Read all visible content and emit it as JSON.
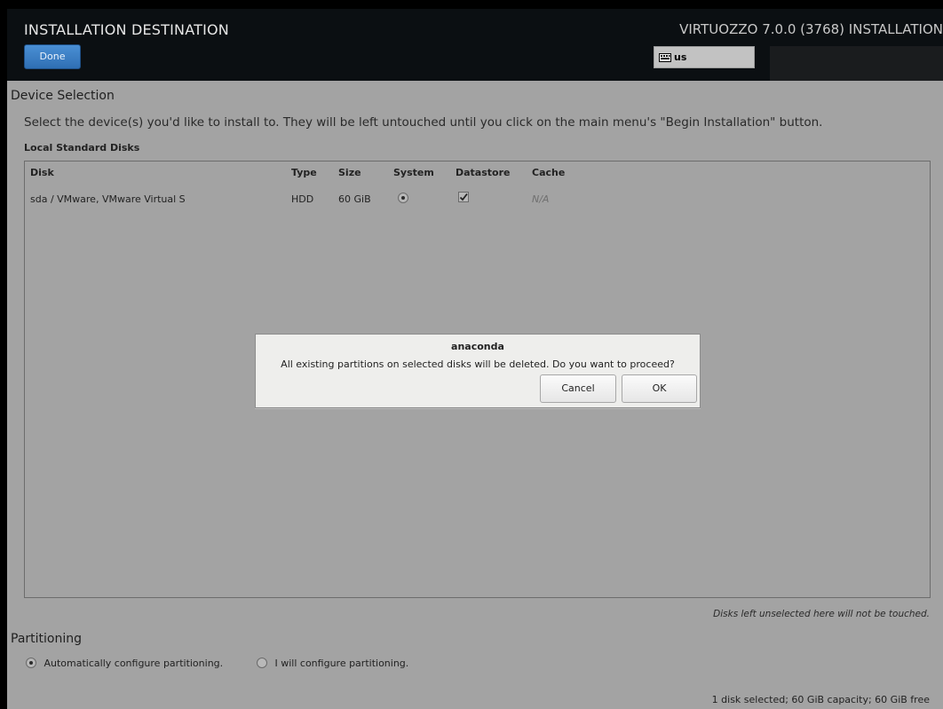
{
  "header": {
    "title": "INSTALLATION DESTINATION",
    "done_label": "Done",
    "product": "VIRTUOZZO 7.0.0 (3768) INSTALLATION",
    "keyboard_layout": "us"
  },
  "device_selection": {
    "title": "Device Selection",
    "instruction": "Select the device(s) you'd like to install to.  They will be left untouched until you click on the main menu's \"Begin Installation\" button.",
    "local_disks_label": "Local Standard Disks",
    "columns": [
      "Disk",
      "Type",
      "Size",
      "System",
      "Datastore",
      "Cache"
    ],
    "rows": [
      {
        "disk": "sda / VMware, VMware Virtual S",
        "type": "HDD",
        "size": "60 GiB",
        "system_selected": true,
        "datastore_checked": true,
        "cache": "N/A"
      }
    ],
    "footnote": "Disks left unselected here will not be touched."
  },
  "partitioning": {
    "title": "Partitioning",
    "auto_label": "Automatically configure partitioning.",
    "manual_label": "I will configure partitioning.",
    "selected": "auto"
  },
  "status": "1 disk selected; 60 GiB capacity; 60 GiB free",
  "dialog": {
    "title": "anaconda",
    "message": "All existing partitions on selected disks will be deleted. Do you want to proceed?",
    "cancel_label": "Cancel",
    "ok_label": "OK"
  }
}
